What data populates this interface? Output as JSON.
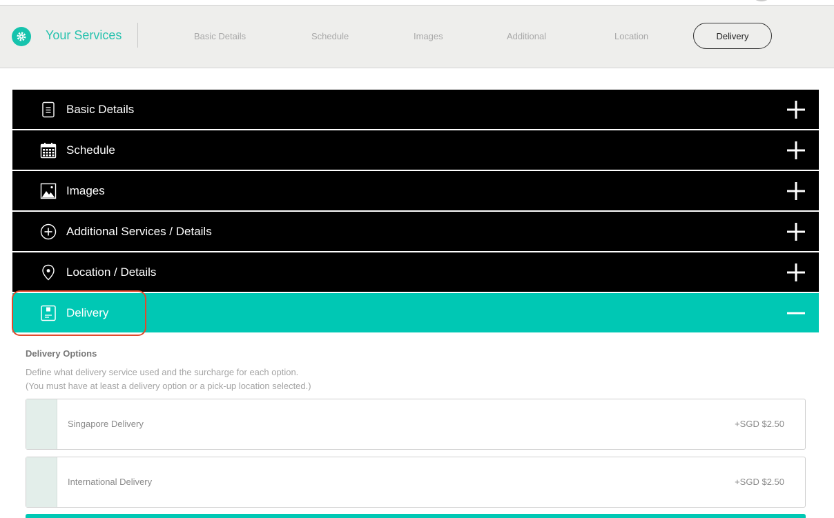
{
  "header": {
    "brand_title": "Your Services",
    "steps": [
      {
        "label": "Basic Details",
        "active": false
      },
      {
        "label": "Schedule",
        "active": false
      },
      {
        "label": "Images",
        "active": false
      },
      {
        "label": "Additional",
        "active": false
      },
      {
        "label": "Location",
        "active": false
      },
      {
        "label": "Delivery",
        "active": true
      }
    ]
  },
  "accordion": [
    {
      "label": "Basic Details",
      "icon": "document-icon",
      "expanded": false
    },
    {
      "label": "Schedule",
      "icon": "calendar-icon",
      "expanded": false
    },
    {
      "label": "Images",
      "icon": "image-icon",
      "expanded": false
    },
    {
      "label": "Additional Services / Details",
      "icon": "plus-circle-icon",
      "expanded": false
    },
    {
      "label": "Location / Details",
      "icon": "location-pin-icon",
      "expanded": false
    },
    {
      "label": "Delivery",
      "icon": "package-icon",
      "expanded": true
    }
  ],
  "delivery": {
    "title": "Delivery Options",
    "description_line1": "Define what delivery service used and the surcharge for each option.",
    "description_line2": "(You must have at least a delivery option or a pick-up location selected.)",
    "options": [
      {
        "name": "Singapore Delivery",
        "price": "+SGD $2.50"
      },
      {
        "name": "International Delivery",
        "price": "+SGD $2.50"
      }
    ]
  },
  "colors": {
    "accent": "#00c8b4",
    "brand_text": "#27c2ae",
    "accordion_bg": "#000000",
    "highlight": "#e04a2c"
  }
}
